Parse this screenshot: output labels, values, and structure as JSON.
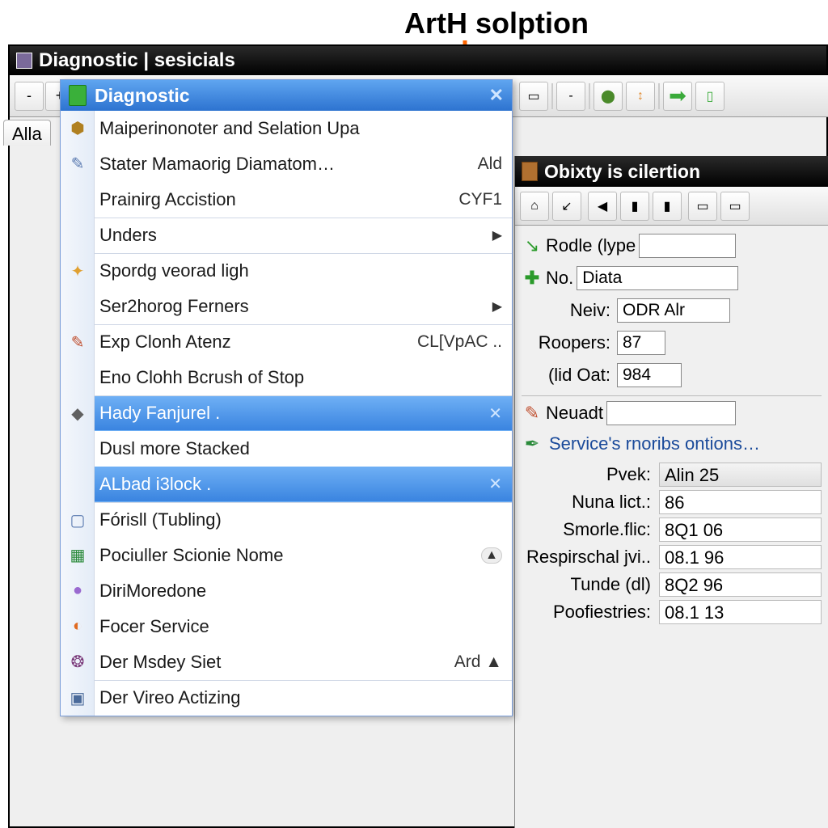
{
  "annotation": {
    "text": "ArtH solption"
  },
  "window": {
    "title": "Diagnostic | sesicials"
  },
  "toolbar_buttons": [
    "-",
    "+",
    "|",
    "□",
    "□",
    "-",
    "|",
    "↕",
    "⇄",
    "➔",
    "▯"
  ],
  "left_tab": {
    "label": "Alla"
  },
  "menu": {
    "header": "Diagnostic",
    "items": [
      {
        "icon": "shield-icon",
        "label": "Maiperinonoter and Selation Upa",
        "shortcut": "",
        "submenu": false,
        "highlight": false,
        "sep": false
      },
      {
        "icon": "wand-icon",
        "label": "Stater Mamaorig Diamatom…",
        "shortcut": "Ald",
        "submenu": false,
        "highlight": false,
        "sep": false
      },
      {
        "icon": "",
        "label": "Prainirg Accistion",
        "shortcut": "CYF1",
        "submenu": false,
        "highlight": false,
        "sep": false
      },
      {
        "icon": "",
        "label": "Unders",
        "shortcut": "",
        "submenu": true,
        "highlight": false,
        "sep": true
      },
      {
        "icon": "star-icon",
        "label": "Spordg veorad ligh",
        "shortcut": "",
        "submenu": false,
        "highlight": false,
        "sep": true
      },
      {
        "icon": "",
        "label": "Ser2horog Ferners",
        "shortcut": "",
        "submenu": true,
        "highlight": false,
        "sep": false
      },
      {
        "icon": "pencil-icon",
        "label": "Exp Clonh Atenz",
        "shortcut": "CL[VpAC  ..",
        "submenu": false,
        "highlight": false,
        "sep": true
      },
      {
        "icon": "",
        "label": "Eno Clohh Bcrush of Stop",
        "shortcut": "",
        "submenu": false,
        "highlight": false,
        "sep": false
      },
      {
        "icon": "diamond-icon",
        "label": "Hady Fanjurel .",
        "shortcut": "",
        "submenu": false,
        "highlight": true,
        "close": true,
        "sep": true
      },
      {
        "icon": "",
        "label": "Dusl more Stacked",
        "shortcut": "",
        "submenu": false,
        "highlight": false,
        "sep": false
      },
      {
        "icon": "",
        "label": "ALbad i3lock .",
        "shortcut": "",
        "submenu": false,
        "highlight": true,
        "close": true,
        "sep": false
      },
      {
        "icon": "square-icon",
        "label": "Fórisll (Tubling)",
        "shortcut": "",
        "submenu": false,
        "highlight": false,
        "sep": true
      },
      {
        "icon": "map-icon",
        "label": "Pociuller Scionie Nome",
        "shortcut": "",
        "submenu": false,
        "highlight": false,
        "arrow_up": true,
        "sep": false
      },
      {
        "icon": "ball-icon",
        "label": "DiriMoredone",
        "shortcut": "",
        "submenu": false,
        "highlight": false,
        "sep": false
      },
      {
        "icon": "firefox-icon",
        "label": "Focer Service",
        "shortcut": "",
        "submenu": false,
        "highlight": false,
        "sep": false
      },
      {
        "icon": "palette-icon",
        "label": "Der Msdey Siet",
        "shortcut": "Ard ▲",
        "submenu": false,
        "highlight": false,
        "sep": false
      },
      {
        "icon": "monitor-icon",
        "label": "Der Vireo Actizing",
        "shortcut": "",
        "submenu": false,
        "highlight": false,
        "sep": true
      }
    ]
  },
  "right_panel": {
    "title": "Obixty is cilertion",
    "toolbar": [
      "⌂",
      "↙",
      "◀",
      "▮",
      "▮",
      "▭",
      "▭"
    ],
    "form": {
      "rodle_label": "Rodle (lype",
      "no_label": "No.",
      "no_value": "Diata",
      "neiv_label": "Neiv:",
      "neiv_value": "ODR Alr",
      "roopers_label": "Roopers:",
      "roopers_value": "87",
      "ildoat_label": "(lid Oat:",
      "ildoat_value": "984",
      "neuadt_label": "Neuadt",
      "service_label": "Service's rnoribs ontions…",
      "grid": [
        {
          "label": "Pvek:",
          "value": "Alin 25"
        },
        {
          "label": "Nuna lict.:",
          "value": "86"
        },
        {
          "label": "Smorle.flic:",
          "value": "8Q1 06"
        },
        {
          "label": "Respirschal jvi..",
          "value": "08.1 96"
        },
        {
          "label": "Tunde (dl)",
          "value": "8Q2 96"
        },
        {
          "label": "Poofiestries:",
          "value": "08.1 13"
        }
      ]
    }
  }
}
